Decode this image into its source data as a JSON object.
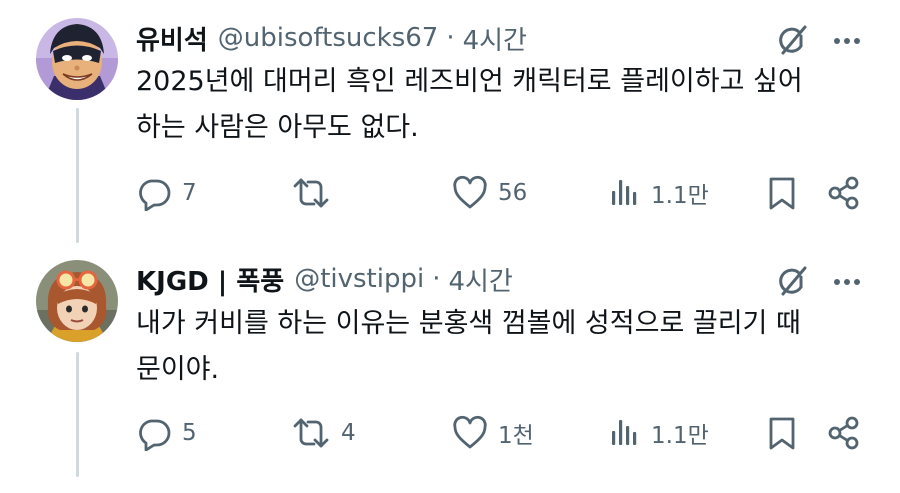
{
  "tweets": [
    {
      "name": "유비석",
      "handle": "@ubisoftsucks67",
      "separator": "·",
      "time": "4시간",
      "text_lines": [
        "2025년에 대머리 흑인 레즈비언 캐릭터로 플레이하고 싶어",
        "하는 사람은 아무도 없다."
      ],
      "replies": "7",
      "reposts": "",
      "likes": "56",
      "views": "1.1만"
    },
    {
      "name": "KJGD | 폭풍",
      "handle": "@tivstippi",
      "separator": "·",
      "time": "4시간",
      "text_lines": [
        "내가 커비를 하는 이유는 분홍색 껌볼에 성적으로 끌리기 때",
        "문이야."
      ],
      "replies": "5",
      "reposts": "4",
      "likes": "1천",
      "views": "1.1만"
    }
  ],
  "icons": {
    "reply": "reply-icon",
    "repost": "repost-icon",
    "like": "heart-icon",
    "views": "views-chart-icon",
    "bookmark": "bookmark-icon",
    "share": "share-icon",
    "grok": "grok-icon",
    "more": "more-icon"
  },
  "colors": {
    "text": "#0f1419",
    "secondary": "#536471",
    "thread_line": "#cfd9de"
  }
}
